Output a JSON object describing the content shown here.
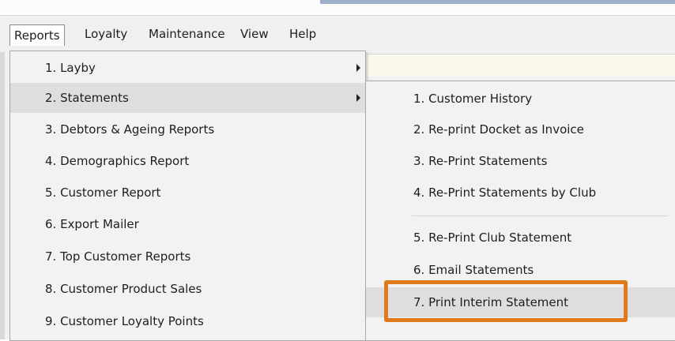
{
  "menubar": {
    "items": [
      {
        "label": "Reports",
        "active": true
      },
      {
        "label": "Loyalty"
      },
      {
        "label": "Maintenance"
      },
      {
        "label": "View"
      },
      {
        "label": "Help"
      }
    ]
  },
  "reports_menu": {
    "items": [
      {
        "label": "1. Layby",
        "submenu": true
      },
      {
        "label": "2. Statements",
        "submenu": true,
        "highlighted": true
      },
      {
        "label": "3. Debtors & Ageing Reports"
      },
      {
        "label": "4. Demographics Report"
      },
      {
        "label": "5. Customer Report"
      },
      {
        "label": "6. Export Mailer"
      },
      {
        "label": "7. Top Customer Reports"
      },
      {
        "label": "8. Customer Product Sales"
      },
      {
        "label": "9. Customer Loyalty Points"
      }
    ]
  },
  "statements_menu": {
    "items": [
      {
        "label": "1. Customer History"
      },
      {
        "label": "2. Re-print Docket as Invoice"
      },
      {
        "label": "3. Re-Print Statements"
      },
      {
        "label": "4. Re-Print Statements by Club"
      },
      {
        "label": "5. Re-Print Club Statement"
      },
      {
        "label": "6. Email Statements"
      },
      {
        "label": "7. Print Interim Statement",
        "highlighted": true
      }
    ]
  },
  "colors": {
    "highlight_box": "#e07a1f",
    "menu_bg": "#f2f2f2",
    "selected_item_bg": "#dedede"
  }
}
